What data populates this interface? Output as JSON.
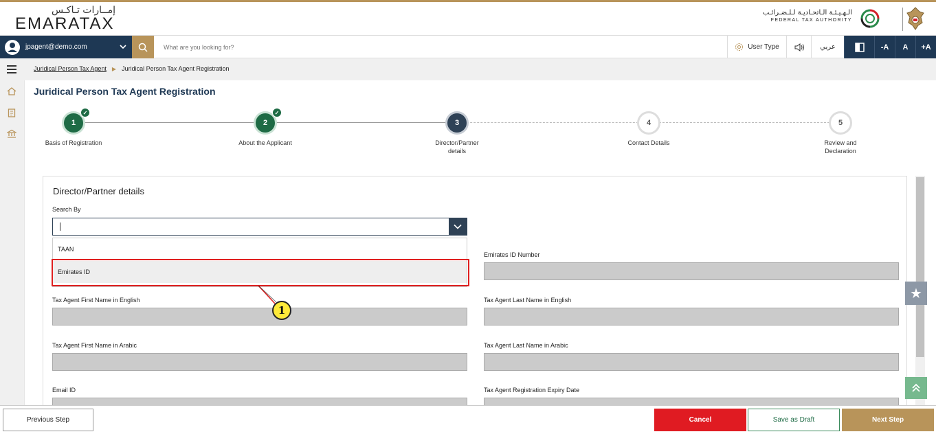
{
  "header": {
    "logo_arabic": "إمــارات تـاكـس",
    "logo_english": "EMARATAX",
    "fta_arabic": "الـهـيـئـة الـاتحـاديـة لـلـضـرائـب",
    "fta_english": "FEDERAL TAX AUTHORITY",
    "fta_emblem_icon": "fta-emblem-icon",
    "uae_emblem_icon": "uae-falcon-emblem-icon"
  },
  "navbar": {
    "user_email": "jpagent@demo.com",
    "user_icon": "user-avatar-icon",
    "search_placeholder": "What are you looking for?",
    "user_type_label": "User Type",
    "arabic_label": "عربي",
    "font_decrease": "-A",
    "font_reset": "A",
    "font_increase": "+A"
  },
  "breadcrumb": {
    "parent": "Juridical Person Tax Agent",
    "current": "Juridical Person Tax Agent Registration"
  },
  "page_title": "Juridical Person Tax Agent Registration",
  "steps": [
    {
      "number": "1",
      "label": "Basis of Registration",
      "state": "done"
    },
    {
      "number": "2",
      "label": "About the Applicant",
      "state": "done"
    },
    {
      "number": "3",
      "label": "Director/Partner details",
      "state": "active"
    },
    {
      "number": "4",
      "label": "Contact Details",
      "state": "todo"
    },
    {
      "number": "5",
      "label": "Review and Declaration",
      "state": "todo"
    }
  ],
  "form": {
    "section_title": "Director/Partner details",
    "search_by_label": "Search By",
    "search_by_value": "",
    "options": [
      "TAAN",
      "Emirates ID"
    ],
    "highlighted_option": "Emirates ID",
    "emirates_id_label": "Emirates ID Number",
    "first_name_en_label": "Tax Agent First Name in English",
    "last_name_en_label": "Tax Agent Last Name in English",
    "first_name_ar_label": "Tax Agent First Name in Arabic",
    "last_name_ar_label": "Tax Agent Last Name in Arabic",
    "email_label": "Email ID",
    "expiry_label": "Tax Agent Registration Expiry Date"
  },
  "annotation": {
    "callout_number": "1"
  },
  "footer": {
    "previous": "Previous Step",
    "cancel": "Cancel",
    "save_draft": "Save as Draft",
    "next": "Next Step"
  },
  "colors": {
    "navy": "#1e3854",
    "gold": "#b8945a",
    "green": "#1e6b45",
    "red": "#e01b22"
  }
}
